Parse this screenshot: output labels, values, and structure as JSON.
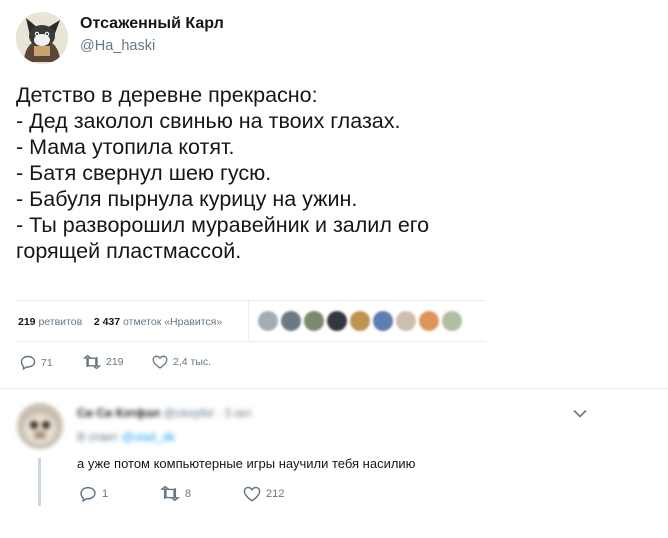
{
  "author": {
    "name": "Отсаженный Карл",
    "handle": "@Ha_haski"
  },
  "tweet": {
    "lines": [
      "Детство в деревне прекрасно:",
      "- Дед заколол свинью на твоих глазах.",
      "- Мама утопила котят.",
      "- Батя свернул шею гусю.",
      "- Бабуля пырнула курицу на ужин.",
      "- Ты разворошил муравейник и залил его",
      "горящей пластмассой."
    ]
  },
  "stats": {
    "retweets_count": "219",
    "retweets_label": "ретвитов",
    "likes_count": "2 437",
    "likes_label": "отметок «Нравится»"
  },
  "actions": {
    "replies": "71",
    "retweets": "219",
    "likes": "2,4 тыс."
  },
  "reply": {
    "name": "Си Си Кэтфэл",
    "handle": "@ckepfel",
    "time": "· 3 окт.",
    "in_reply_prefix": "В ответ",
    "in_reply_handle": "@vlad_dk",
    "text": "а уже потом компьютерные игры научили тебя насилию",
    "replies": "1",
    "retweets": "8",
    "likes": "212"
  },
  "colors": {
    "text": "#14171a",
    "secondary": "#657786",
    "link": "#1da1f2",
    "divider": "#e6ecf0"
  },
  "icons": [
    "reply-icon",
    "retweet-icon",
    "heart-icon",
    "chevron-down-icon"
  ]
}
